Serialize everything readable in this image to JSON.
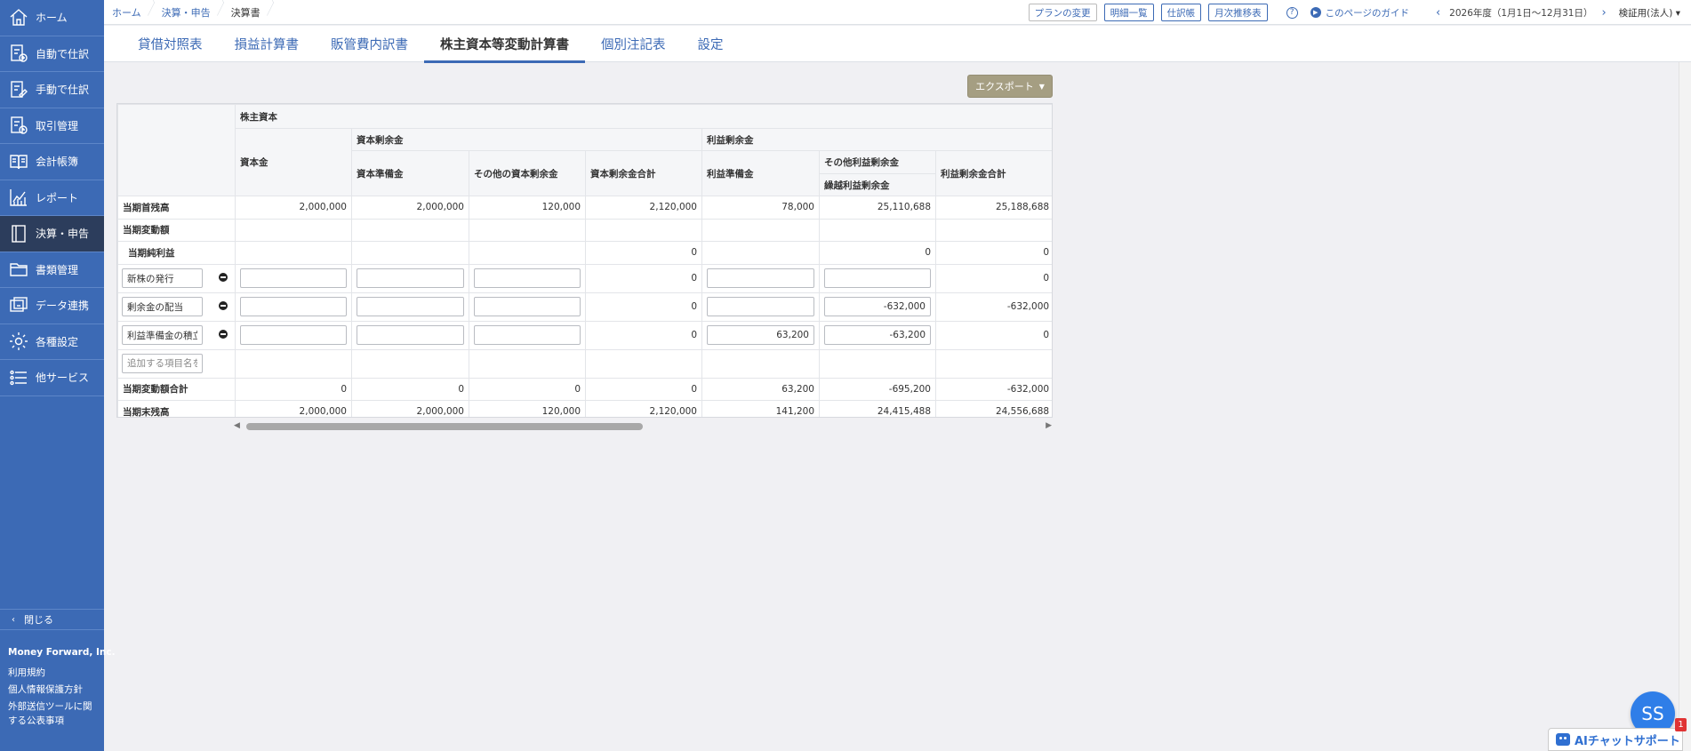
{
  "sidebar": {
    "items": [
      {
        "label": "ホーム",
        "icon": "home-icon"
      },
      {
        "label": "自動で仕訳",
        "icon": "auto-journal-icon"
      },
      {
        "label": "手動で仕訳",
        "icon": "manual-journal-icon"
      },
      {
        "label": "取引管理",
        "icon": "transaction-icon"
      },
      {
        "label": "会計帳簿",
        "icon": "ledger-icon"
      },
      {
        "label": "レポート",
        "icon": "report-icon"
      },
      {
        "label": "決算・申告",
        "icon": "settlement-icon",
        "active": true
      },
      {
        "label": "書類管理",
        "icon": "folder-icon"
      },
      {
        "label": "データ連携",
        "icon": "data-link-icon"
      },
      {
        "label": "各種設定",
        "icon": "gear-icon"
      },
      {
        "label": "他サービス",
        "icon": "list-icon"
      }
    ],
    "close_label": "閉じる",
    "company": "Money Forward, Inc.",
    "footer_links": [
      "利用規約",
      "個人情報保護方針",
      "外部送信ツールに関する公表事項"
    ]
  },
  "breadcrumb": [
    "ホーム",
    "決算・申告",
    "決算書"
  ],
  "top_actions": {
    "plan": "プランの変更",
    "details": "明細一覧",
    "journal": "仕訳帳",
    "monthly": "月次推移表",
    "help": "?",
    "guide": "このページのガイド",
    "period": "2026年度（1月1日〜12月31日）",
    "entity": "検証用(法人)"
  },
  "tabs": [
    {
      "label": "貸借対照表"
    },
    {
      "label": "損益計算書"
    },
    {
      "label": "販管費内訳書"
    },
    {
      "label": "株主資本等変動計算書",
      "active": true
    },
    {
      "label": "個別注記表"
    },
    {
      "label": "設定"
    }
  ],
  "export_label": "エクスポート",
  "table": {
    "header": {
      "shareholders_equity": "株主資本",
      "capital": "資本金",
      "capital_surplus": "資本剰余金",
      "capital_reserve": "資本準備金",
      "other_capital_surplus": "その他の資本剰余金",
      "capital_surplus_total": "資本剰余金合計",
      "retained_earnings": "利益剰余金",
      "legal_reserve": "利益準備金",
      "other_retained": "その他利益剰余金",
      "carried_forward": "繰越利益剰余金",
      "retained_total": "利益剰余金合計"
    },
    "opening": {
      "label": "当期首残高",
      "v": [
        "2,000,000",
        "2,000,000",
        "120,000",
        "2,120,000",
        "78,000",
        "25,110,688",
        "25,188,688"
      ]
    },
    "changes_label": "当期変動額",
    "net_income": {
      "label": "当期純利益",
      "v": [
        "",
        "",
        "",
        "0",
        "",
        "0",
        "0"
      ]
    },
    "items": [
      {
        "name": "新株の発行",
        "inputs": [
          "",
          "",
          ""
        ],
        "cap_total": "0",
        "legal": "",
        "carried": "",
        "ret_total": "0"
      },
      {
        "name": "剰余金の配当",
        "inputs": [
          "",
          "",
          ""
        ],
        "cap_total": "0",
        "legal": "",
        "carried": "-632,000",
        "ret_total": "-632,000"
      },
      {
        "name": "利益準備金の積立",
        "inputs": [
          "",
          "",
          ""
        ],
        "cap_total": "0",
        "legal": "63,200",
        "carried": "-63,200",
        "ret_total": "0"
      }
    ],
    "add_placeholder": "追加する項目名を入力",
    "change_total": {
      "label": "当期変動額合計",
      "v": [
        "0",
        "0",
        "0",
        "0",
        "63,200",
        "-695,200",
        "-632,000"
      ]
    },
    "closing": {
      "label": "当期末残高",
      "v": [
        "2,000,000",
        "2,000,000",
        "120,000",
        "2,120,000",
        "141,200",
        "24,415,488",
        "24,556,688"
      ]
    }
  },
  "scroll_position": 0.5,
  "avatar_initials": "SS",
  "ai_chat_label": "AIチャットサポート",
  "ai_badge_count": "1"
}
